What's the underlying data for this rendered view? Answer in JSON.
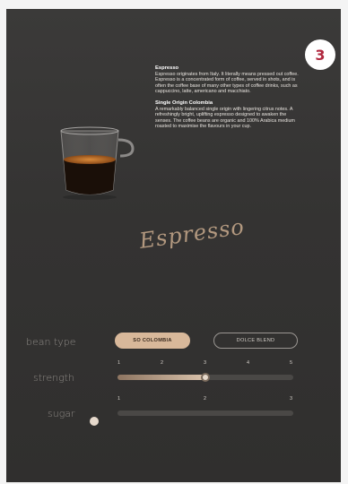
{
  "step_badge": "3",
  "description": {
    "espresso_heading": "Espresso",
    "espresso_text": "Espresso originates from Italy. It literally means pressed out coffee. Espresso is a concentrated form of coffee, served in shots, and is often the coffee base of many other types of coffee drinks, such as cappuccino, latte, americano and macchiato.",
    "origin_heading": "Single Origin Colombia",
    "origin_text": "A remarkably balanced single origin with lingering citrus notes. A refreshingly bright, uplifting espresso designed to awaken the senses. The coffee beans are organic and 100% Arabica medium roasted to maximise the flavours in your cup."
  },
  "script_title": "Espresso",
  "bean_type": {
    "label": "bean type",
    "options": [
      "SO COLOMBIA",
      "DOLCE BLEND"
    ],
    "selected": "SO COLOMBIA"
  },
  "strength": {
    "label": "strength",
    "ticks": [
      "1",
      "2",
      "3",
      "4",
      "5"
    ],
    "value": 3,
    "max": 5
  },
  "sugar": {
    "label": "sugar",
    "ticks": [
      "1",
      "2",
      "3"
    ],
    "value": 0,
    "max": 3
  },
  "icons": {
    "step": "step-number-badge",
    "cup": "espresso-cup-image",
    "sugar": "sugar-cube-icon"
  },
  "colors": {
    "accent": "#d8b89a",
    "badge_text": "#b0283f",
    "panel_bg": "#363534"
  }
}
